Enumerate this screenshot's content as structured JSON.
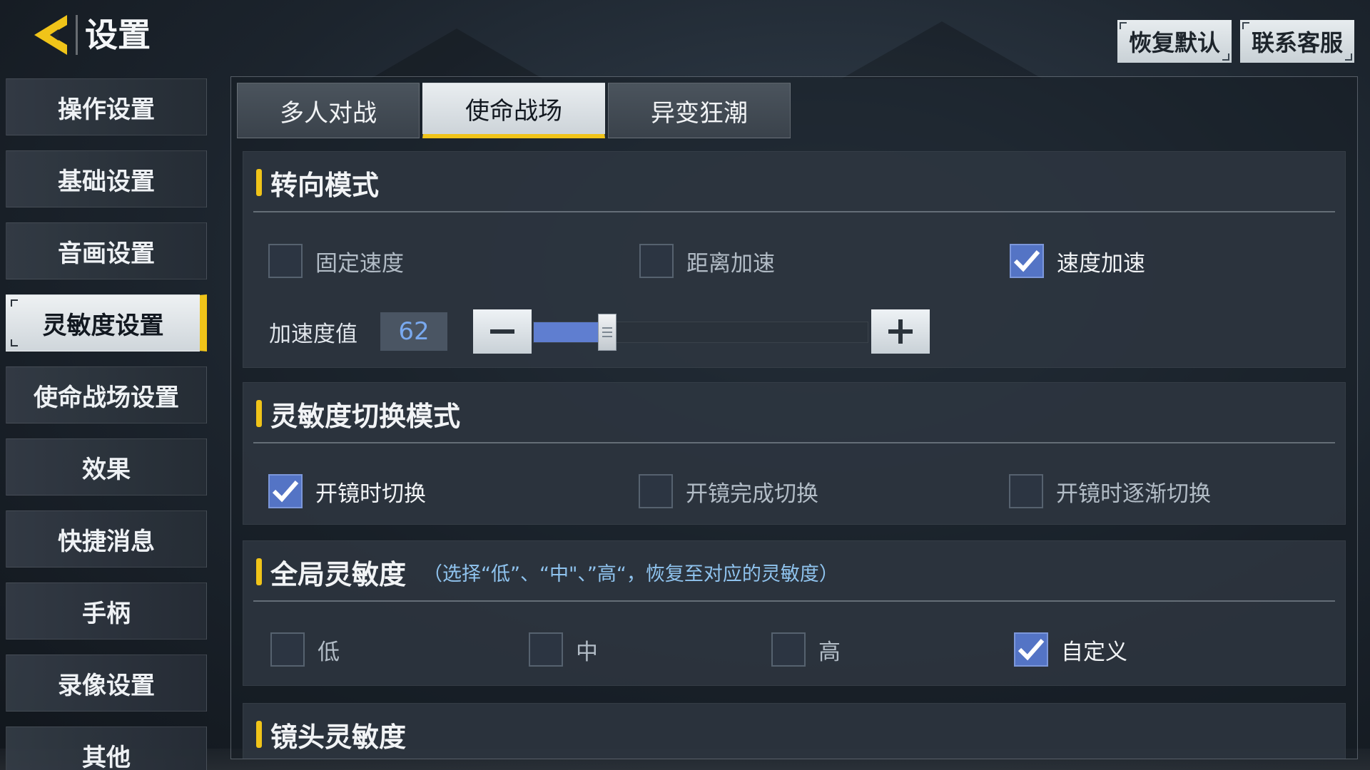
{
  "header": {
    "title": "设置"
  },
  "top_buttons": {
    "restore_default": "恢复默认",
    "contact_support": "联系客服"
  },
  "sidebar": {
    "items": [
      {
        "label": "操作设置",
        "active": false
      },
      {
        "label": "基础设置",
        "active": false
      },
      {
        "label": "音画设置",
        "active": false
      },
      {
        "label": "灵敏度设置",
        "active": true
      },
      {
        "label": "使命战场设置",
        "active": false
      },
      {
        "label": "效果",
        "active": false
      },
      {
        "label": "快捷消息",
        "active": false
      },
      {
        "label": "手柄",
        "active": false
      },
      {
        "label": "录像设置",
        "active": false
      },
      {
        "label": "其他",
        "active": false
      }
    ]
  },
  "tabs": [
    {
      "label": "多人对战",
      "active": false
    },
    {
      "label": "使命战场",
      "active": true
    },
    {
      "label": "异变狂潮",
      "active": false
    }
  ],
  "turn_mode": {
    "title": "转向模式",
    "options": [
      {
        "label": "固定速度",
        "checked": false
      },
      {
        "label": "距离加速",
        "checked": false
      },
      {
        "label": "速度加速",
        "checked": true
      }
    ],
    "accel": {
      "label": "加速度值",
      "value": "62",
      "fill_fraction": 0.2
    }
  },
  "switch_mode": {
    "title": "灵敏度切换模式",
    "options": [
      {
        "label": "开镜时切换",
        "checked": true
      },
      {
        "label": "开镜完成切换",
        "checked": false
      },
      {
        "label": "开镜时逐渐切换",
        "checked": false
      }
    ]
  },
  "global_sensitivity": {
    "title": "全局灵敏度",
    "note": "（选择“低”、“中\"、”高“，恢复至对应的灵敏度）",
    "options": [
      {
        "label": "低",
        "checked": false
      },
      {
        "label": "中",
        "checked": false
      },
      {
        "label": "高",
        "checked": false
      },
      {
        "label": "自定义",
        "checked": true
      }
    ]
  },
  "scope_sensitivity": {
    "title": "镜头灵敏度"
  },
  "colors": {
    "accent_yellow": "#f0c419",
    "check_blue": "#5474c5",
    "note_blue": "#8fc3ee"
  }
}
